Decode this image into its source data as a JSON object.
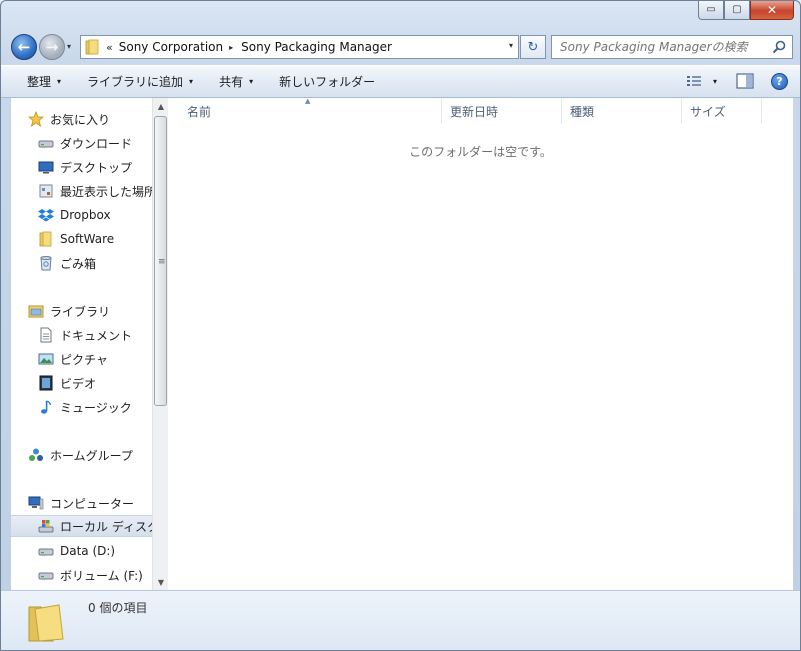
{
  "window": {
    "caption_buttons": {
      "minimize": "▭",
      "maximize": "▢",
      "close": "✕"
    }
  },
  "navbar": {
    "back_glyph": "←",
    "forward_glyph": "→",
    "address": {
      "overflow_glyph": "«",
      "segments": [
        "Sony Corporation",
        "Sony Packaging Manager"
      ],
      "separator_glyph": "▸",
      "dropdown_glyph": "▾"
    },
    "refresh_glyph": "↻",
    "search": {
      "placeholder": "Sony Packaging Managerの検索"
    }
  },
  "toolbar": {
    "organize_label": "整理",
    "add_to_library_label": "ライブラリに追加",
    "share_label": "共有",
    "new_folder_label": "新しいフォルダー",
    "dropdown_glyph": "▾",
    "help_glyph": "?"
  },
  "nav_pane": {
    "favorites": {
      "label": "お気に入り",
      "items": [
        "ダウンロード",
        "デスクトップ",
        "最近表示した場所",
        "Dropbox",
        "SoftWare",
        "ごみ箱"
      ]
    },
    "libraries": {
      "label": "ライブラリ",
      "items": [
        "ドキュメント",
        "ピクチャ",
        "ビデオ",
        "ミュージック"
      ]
    },
    "homegroup": {
      "label": "ホームグループ"
    },
    "computer": {
      "label": "コンピューター",
      "items": [
        "ローカル ディスク (C:)",
        "Data (D:)",
        "ボリューム (F:)"
      ]
    }
  },
  "content": {
    "columns": [
      "名前",
      "更新日時",
      "種類",
      "サイズ"
    ],
    "empty_message": "このフォルダーは空です。"
  },
  "status": {
    "item_count_text": "0 個の項目"
  },
  "colors": {
    "accent": "#2e6fc4",
    "close_button": "#c7452d",
    "header_text": "#4c607a"
  }
}
